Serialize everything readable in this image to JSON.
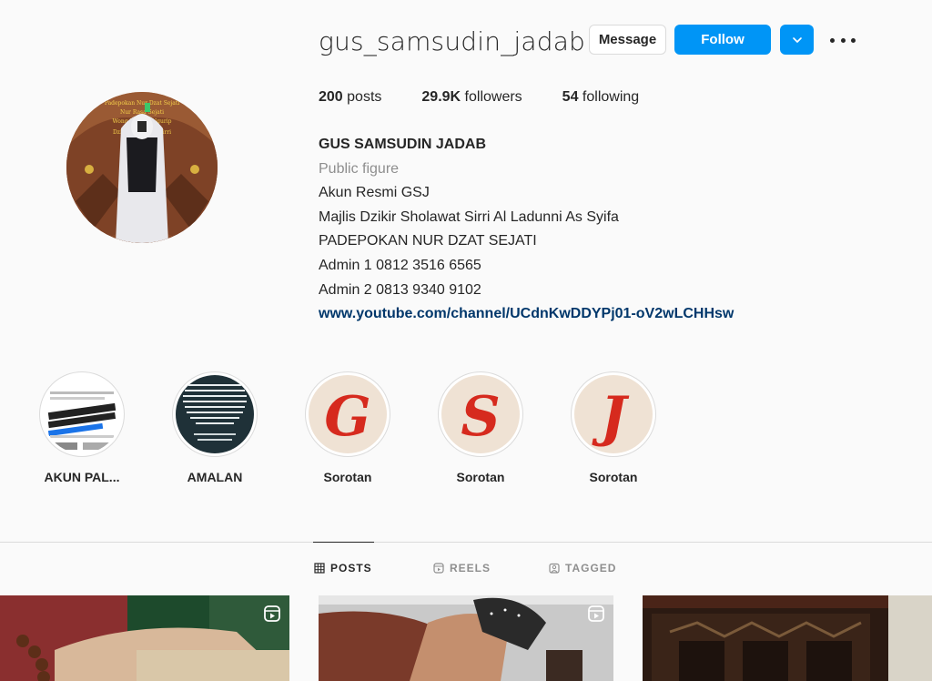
{
  "profile": {
    "username": "gus_samsudin_jadab",
    "message_label": "Message",
    "follow_label": "Follow",
    "stats": {
      "posts_count": "200",
      "posts_label": " posts",
      "followers_count": "29.9K",
      "followers_label": " followers",
      "following_count": "54",
      "following_label": " following"
    },
    "full_name": "GUS SAMSUDIN JADAB",
    "category": "Public figure",
    "bio_lines": [
      "Akun Resmi GSJ",
      "Majlis Dzikir Sholawat Sirri Al Ladunni As Syifa",
      "PADEPOKAN NUR DZAT SEJATI",
      "Admin 1 0812 3516 6565",
      "Admin 2 0813 9340 9102"
    ],
    "link": "www.youtube.com/channel/UCdnKwDDYPj01-oV2wLCHHsw"
  },
  "highlights": [
    {
      "label": "AKUN PAL..."
    },
    {
      "label": "AMALAN"
    },
    {
      "label": "Sorotan",
      "letter": "G"
    },
    {
      "label": "Sorotan",
      "letter": "S"
    },
    {
      "label": "Sorotan",
      "letter": "J"
    }
  ],
  "tabs": [
    {
      "label": "POSTS",
      "icon": "grid-icon"
    },
    {
      "label": "REELS",
      "icon": "reels-icon"
    },
    {
      "label": "TAGGED",
      "icon": "tagged-icon"
    }
  ],
  "colors": {
    "accent": "#0095f6",
    "link": "#00376b",
    "muted": "#8e8e8e",
    "text": "#262626",
    "background": "#fafafa",
    "border": "#dbdbdb"
  }
}
